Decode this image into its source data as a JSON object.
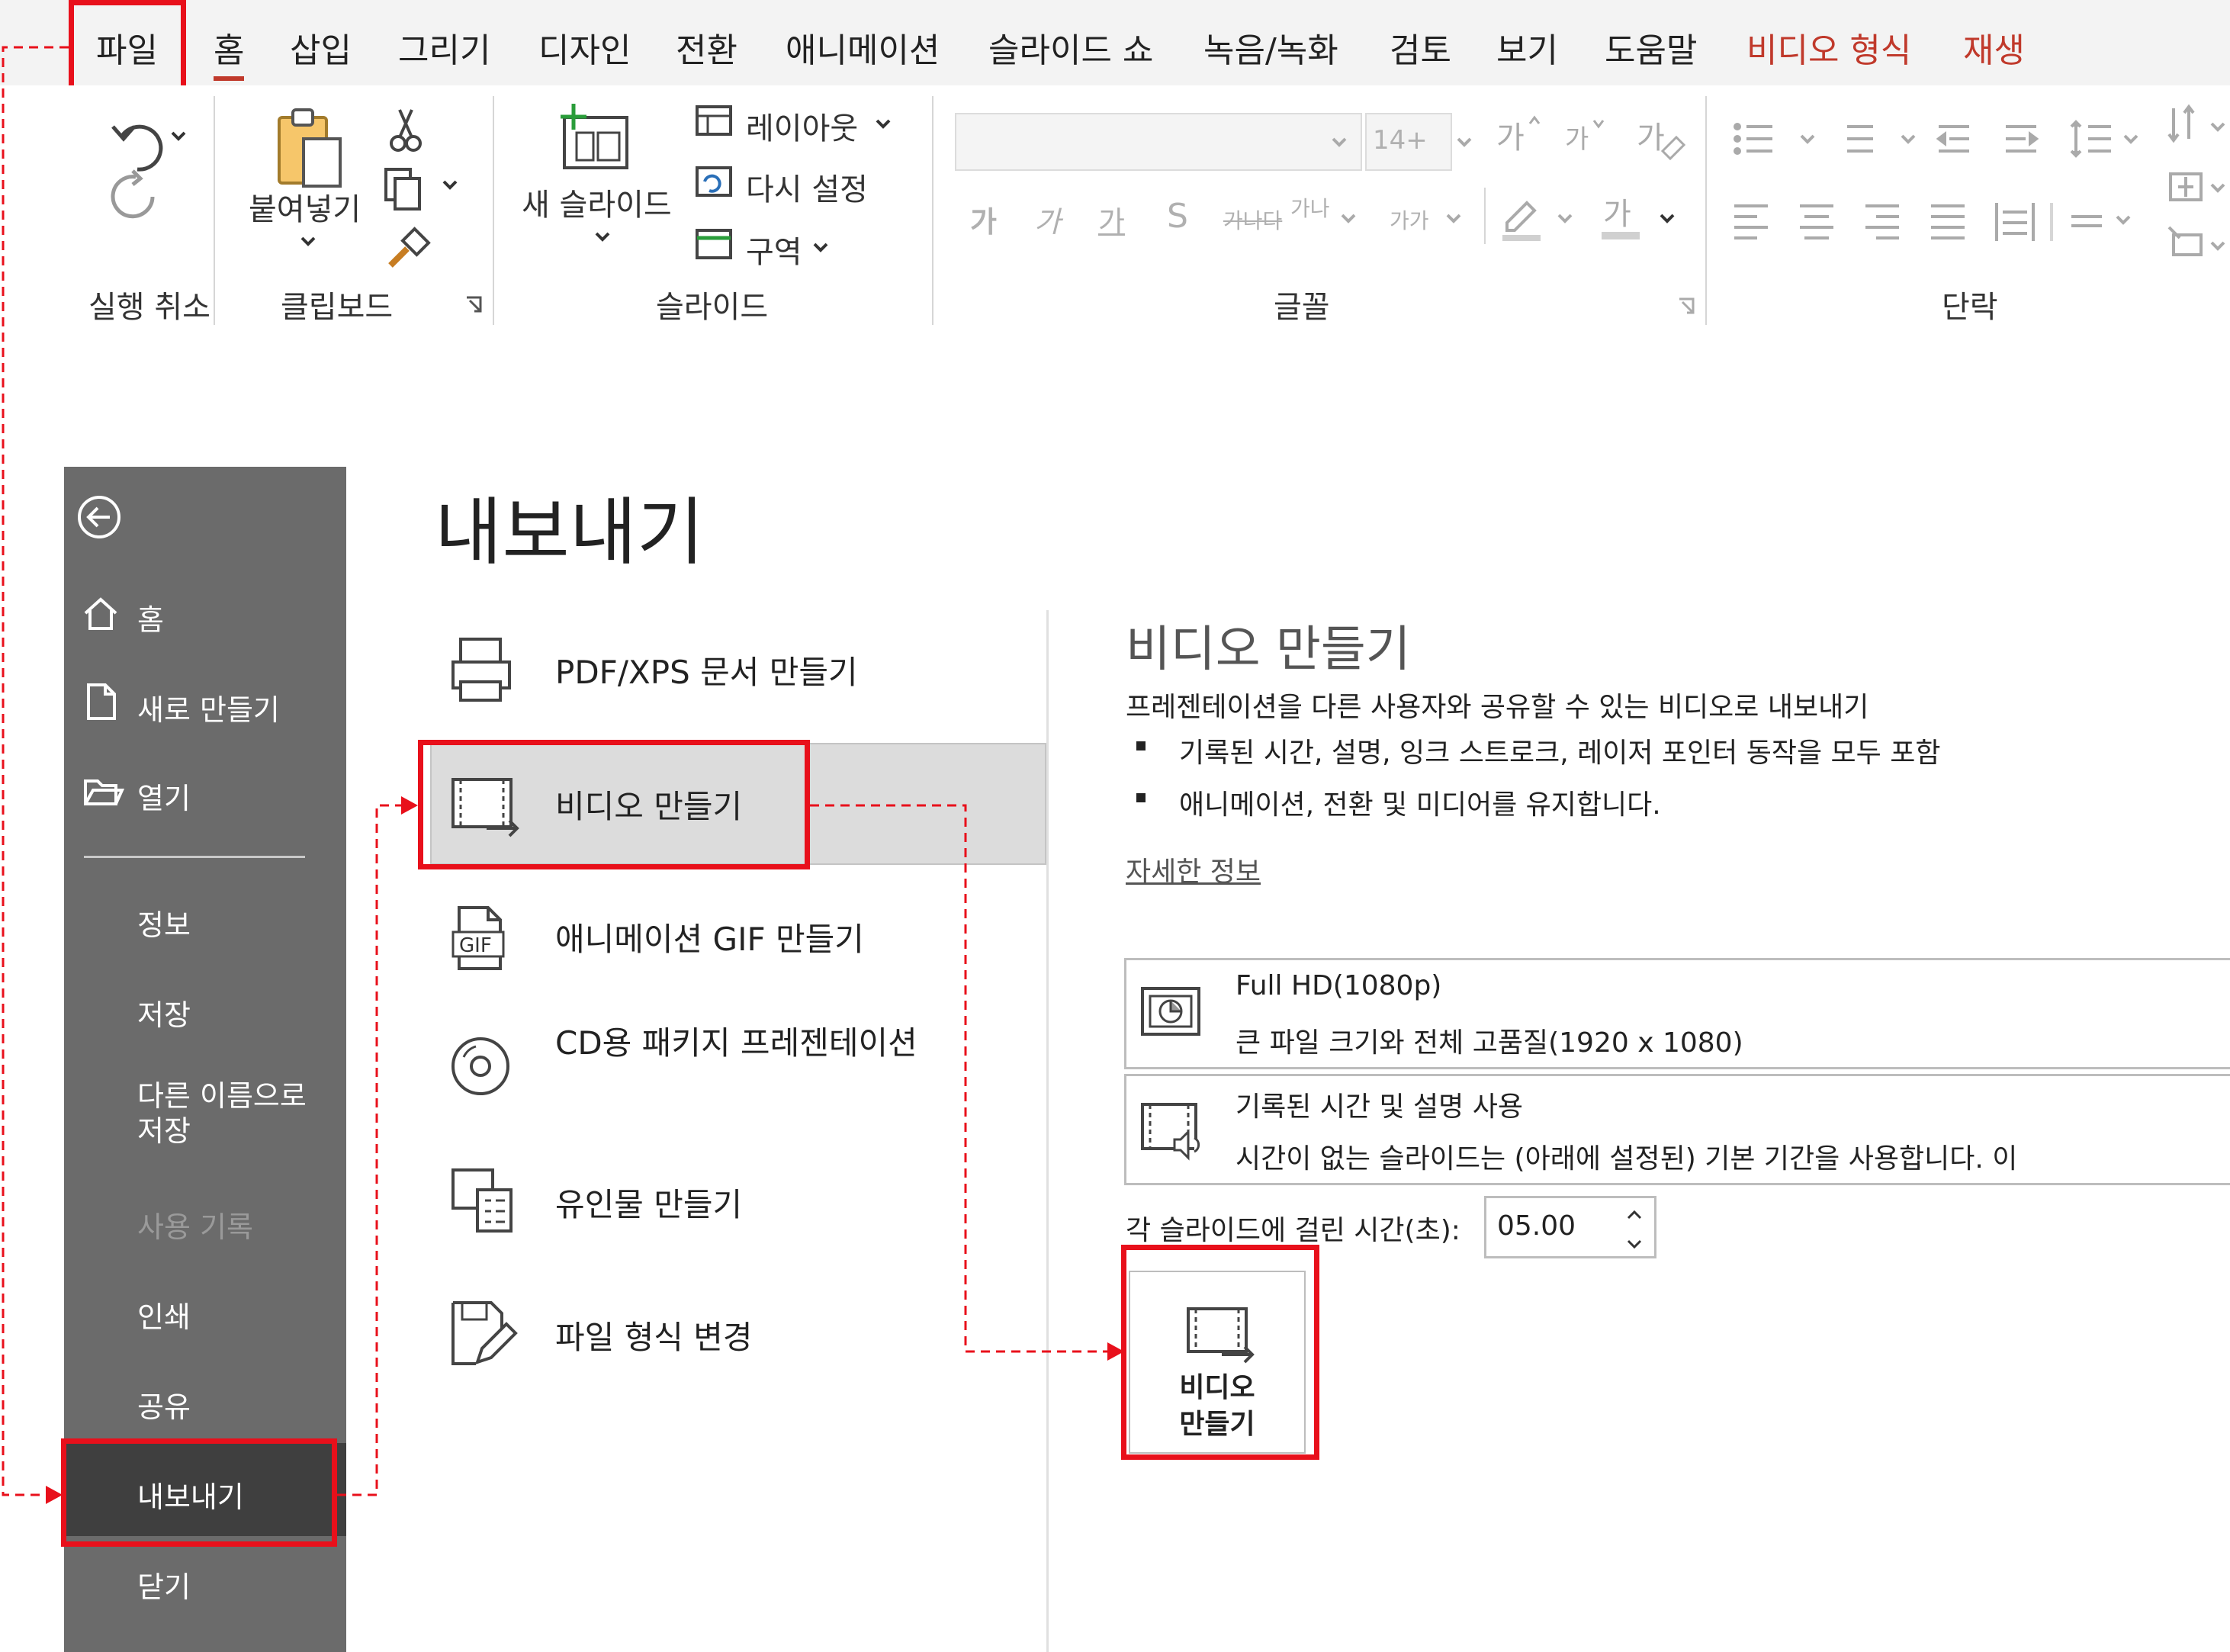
{
  "ribbon": {
    "tabs": [
      "파일",
      "홈",
      "삽입",
      "그리기",
      "디자인",
      "전환",
      "애니메이션",
      "슬라이드 쇼",
      "녹음/녹화",
      "검토",
      "보기",
      "도움말",
      "비디오 형식",
      "재생"
    ],
    "groups": {
      "undo": "실행 취소",
      "clipboard": "클립보드",
      "slides": "슬라이드",
      "font": "글꼴",
      "paragraph": "단락"
    },
    "paste_label": "붙여넣기",
    "new_slide_label": "새 슬라이드",
    "layout_label": "레이아웃",
    "reset_label": "다시 설정",
    "section_label": "구역",
    "font_size_placeholder": "14+",
    "font_buttons": [
      "가",
      "가",
      "가",
      "S",
      "가나",
      "가가"
    ]
  },
  "sidebar": {
    "items": [
      "홈",
      "새로 만들기",
      "열기",
      "정보",
      "저장",
      "다른 이름으로\n저장",
      "사용 기록",
      "인쇄",
      "공유",
      "내보내기",
      "닫기"
    ]
  },
  "export": {
    "title": "내보내기",
    "options": [
      "PDF/XPS 문서 만들기",
      "비디오 만들기",
      "애니메이션 GIF 만들기",
      "CD용 패키지 프레젠테이션",
      "유인물 만들기",
      "파일 형식 변경"
    ]
  },
  "video": {
    "title": "비디오 만들기",
    "description": "프레젠테이션을 다른 사용자와 공유할 수 있는 비디오로 내보내기",
    "bullets": [
      "기록된 시간, 설명, 잉크 스트로크, 레이저 포인터 동작을 모두 포함",
      "애니메이션, 전환 및 미디어를 유지합니다."
    ],
    "more_info": "자세한 정보",
    "quality_title": "Full HD(1080p)",
    "quality_desc": "큰 파일 크기와 전체 고품질(1920 x 1080)",
    "timing_title": "기록된 시간 및 설명 사용",
    "timing_desc": "시간이 없는 슬라이드는 (아래에 설정된) 기본 기간을 사용합니다. 이 ",
    "seconds_label": "각 슬라이드에 걸린 시간(초):",
    "seconds_value": "05.00",
    "create_button": "비디오\n만들기"
  },
  "colors": {
    "highlight": "#e8101b",
    "accent": "#c0392b",
    "sidebar": "#6b6b6b"
  }
}
